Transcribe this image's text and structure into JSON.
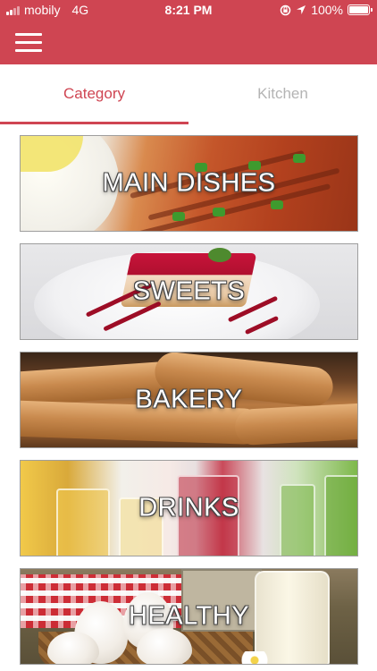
{
  "status_bar": {
    "carrier": "mobily",
    "network": "4G",
    "time": "8:21 PM",
    "battery_percent": "100%",
    "icons": [
      "signal-icon",
      "rotation-lock-icon",
      "location-icon",
      "battery-icon"
    ]
  },
  "header": {
    "menu_icon": "hamburger-menu-icon",
    "background_color": "#cf4552"
  },
  "tabs": [
    {
      "label": "Category",
      "active": true
    },
    {
      "label": "Kitchen",
      "active": false
    }
  ],
  "categories": [
    {
      "title": "MAIN DISHES"
    },
    {
      "title": "SWEETS"
    },
    {
      "title": "BAKERY"
    },
    {
      "title": "DRINKS"
    },
    {
      "title": "HEALTHY"
    }
  ],
  "colors": {
    "accent": "#cf4552",
    "inactive_tab": "#b4b4b4"
  }
}
